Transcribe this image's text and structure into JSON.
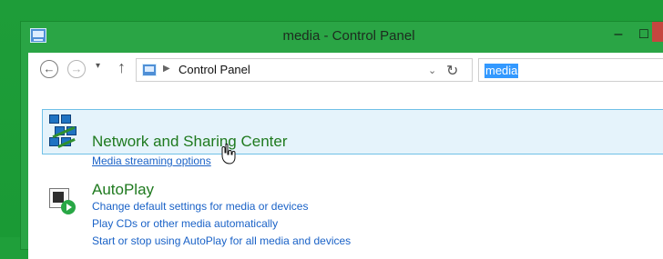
{
  "window": {
    "title": "media - Control Panel"
  },
  "navigation": {
    "location": "Control Panel"
  },
  "search": {
    "query": "media"
  },
  "results": [
    {
      "title": "Network and Sharing Center",
      "links": [
        "Media streaming options"
      ]
    },
    {
      "title": "AutoPlay",
      "links": [
        "Change default settings for media or devices",
        "Play CDs or other media automatically",
        "Start or stop using AutoPlay for all media and devices"
      ]
    }
  ],
  "icons": {
    "window_icon": "control-panel-icon",
    "network": "network-sharing-icon",
    "autoplay": "autoplay-icon",
    "cursor": "hand-pointer-icon"
  }
}
